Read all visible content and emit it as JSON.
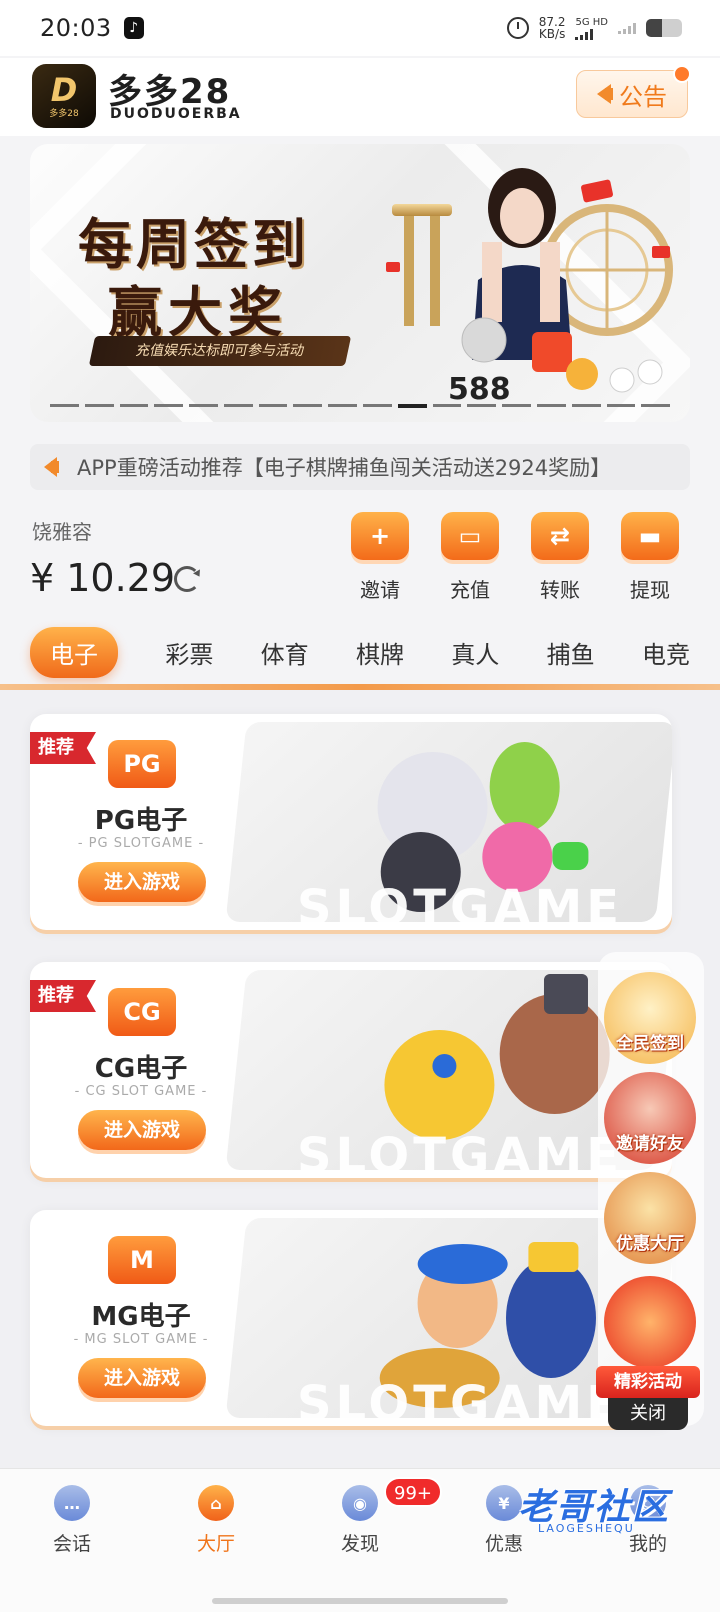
{
  "status_bar": {
    "time": "20:03",
    "net_speed_value": "87.2",
    "net_speed_unit": "KB/s",
    "network_type": "5G HD",
    "battery_level": 0.45
  },
  "header": {
    "logo_mark": "D",
    "logo_mark_sub": "多多28",
    "brand_name": "多多28",
    "brand_sub": "DUODUOERBA",
    "notice_label": "公告"
  },
  "banner": {
    "title_line1": "每周签到",
    "title_line2": "赢大奖",
    "subtitle": "充值娱乐达标即可参与活动",
    "number": "588",
    "slide_count": 18,
    "slide_index": 10
  },
  "marquee": {
    "text": "APP重磅活动推荐【电子棋牌捕鱼闯关活动送2924奖励】"
  },
  "wallet": {
    "username": "饶雅容",
    "balance": "¥ 10.29"
  },
  "actions": [
    {
      "label": "邀请",
      "icon": "invite-icon",
      "glyph": "+"
    },
    {
      "label": "充值",
      "icon": "wallet-icon",
      "glyph": "▭"
    },
    {
      "label": "转账",
      "icon": "transfer-icon",
      "glyph": "⇄"
    },
    {
      "label": "提现",
      "icon": "card-icon",
      "glyph": "▬"
    }
  ],
  "tabs": [
    "电子",
    "彩票",
    "体育",
    "棋牌",
    "真人",
    "捕鱼",
    "电竞"
  ],
  "active_tab": 0,
  "games": [
    {
      "badge": "推荐",
      "logo": "PG",
      "name": "PG电子",
      "subname": "- PG SLOTGAME -",
      "button": "进入游戏",
      "art_text": "SLOTGAME"
    },
    {
      "badge": "推荐",
      "logo": "CG",
      "name": "CG电子",
      "subname": "- CG SLOT GAME -",
      "button": "进入游戏",
      "art_text": "SLOTGAME"
    },
    {
      "badge": "",
      "logo": "M",
      "name": "MG电子",
      "subname": "- MG SLOT GAME -",
      "button": "进入游戏",
      "art_text": "SLOTGAME"
    }
  ],
  "promos": [
    {
      "label": "全民签到",
      "color": "#f7c66a"
    },
    {
      "label": "邀请好友",
      "color": "#e85a3a"
    },
    {
      "label": "优惠大厅",
      "color": "#e9a04a"
    }
  ],
  "promo_main_label": "精彩活动",
  "close_label": "关闭",
  "bottom_nav": [
    {
      "label": "会话",
      "icon": "chat-icon",
      "glyph": "…"
    },
    {
      "label": "大厅",
      "icon": "hall-icon",
      "glyph": "⌂"
    },
    {
      "label": "发现",
      "icon": "discover-icon",
      "glyph": "◉",
      "badge": "99+"
    },
    {
      "label": "优惠",
      "icon": "gift-icon",
      "glyph": "¥"
    },
    {
      "label": "我的",
      "icon": "profile-icon",
      "glyph": "☺"
    }
  ],
  "active_nav": 1,
  "watermark": {
    "text": "老哥社区",
    "sub": "LAOGESHEQU"
  },
  "colors": {
    "accent": "#f06a1a",
    "badge_red": "#d8282e",
    "nav_blue": "#6a8ad8"
  }
}
